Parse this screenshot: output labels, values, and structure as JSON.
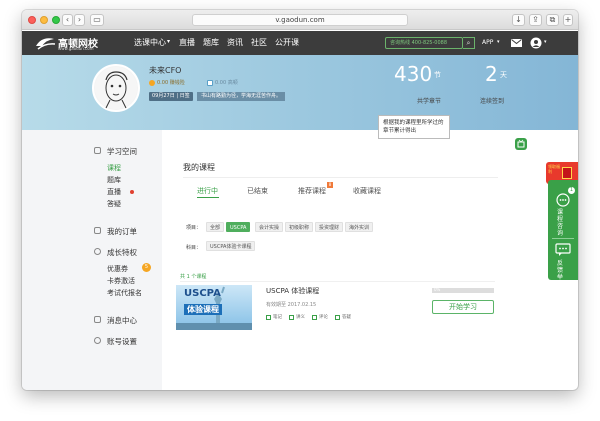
{
  "browser": {
    "url": "v.gaodun.com"
  },
  "nav": {
    "logo_text": "高顿网校",
    "logo_sub": "www.gaodun.com",
    "links": [
      "选课中心",
      "直播",
      "题库",
      "资讯",
      "社区",
      "公开课"
    ],
    "select_arrow": "▾",
    "search_placeholder": "咨询热线 400-825-0088",
    "app_label": "APP",
    "app_arrow": "▾",
    "avatar_arrow": "▾"
  },
  "banner": {
    "username": "未来CFO",
    "badge1": "0.00 赚钱险",
    "badge2": "0.00 高顿",
    "date_tag": "09月27日 | 日签",
    "quote": "书山有路勤为径，学海无涯苦作舟。",
    "study_num": "430",
    "study_unit": "节",
    "study_label": "共学章节",
    "sign_num": "2",
    "sign_unit": "天",
    "sign_label": "连续签到",
    "tooltip": "根据我的课程里所学过的章节累计得出"
  },
  "sidebar": {
    "learn_space": "学习空间",
    "learn_items": [
      "课程",
      "题库",
      "直播",
      "答疑"
    ],
    "my_orders": "我的订单",
    "privilege": "成长特权",
    "privilege_items": [
      "优惠券",
      "卡券激活",
      "考试代报名"
    ],
    "coupon_count": "5",
    "messages": "消息中心",
    "settings": "账号设置"
  },
  "main": {
    "title": "我的课程",
    "tabs": [
      "进行中",
      "已结束",
      "推荐课程",
      "收藏课程"
    ],
    "tab_badge": "8",
    "project_label": "项目：",
    "projects": [
      "全部",
      "USCPA",
      "会计实操",
      "初级职称",
      "投资理财",
      "海外实训"
    ],
    "subject_label": "科目：",
    "subjects": [
      "USCPA体验卡课程"
    ],
    "count_text": "共 1 个课程",
    "course": {
      "banner_top": "USCPA",
      "banner_bottom": "体验课程",
      "name": "USCPA 体验课程",
      "expire": "有效期至 2017.02.15",
      "actions": [
        "笔记",
        "讲义",
        "评论",
        "答疑"
      ],
      "progress": 0,
      "progress_label": "0%",
      "button": "开始学习"
    }
  },
  "floating": {
    "redbag": "领取福利",
    "badge": "1",
    "consult": "课程咨询",
    "feedback": "反馈举报"
  },
  "colors": {
    "accent": "#3aa048",
    "nav_bg": "#3c3c3c",
    "banner": "#9cc8df"
  }
}
